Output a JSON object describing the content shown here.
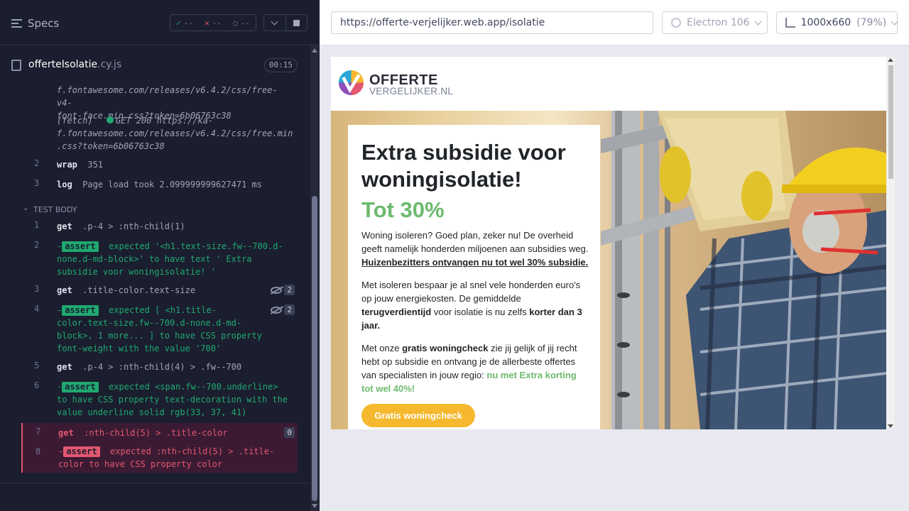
{
  "reporter": {
    "specs_label": "Specs",
    "stats": {
      "passed": "--",
      "failed": "--",
      "pending": "--"
    },
    "spec_file": {
      "name": "offerteIsolatie",
      "ext": ".cy.js",
      "timer": "00:15"
    },
    "log_lines": [
      {
        "num": "",
        "lines": [
          "f.fontawesome.com/releases/v6.4.2/css/free-v4-",
          "font-face.min.css?token=6b06763c38"
        ]
      },
      {
        "num": "",
        "prefix": "(fetch)",
        "method": "GET 200",
        "lines": [
          "https://ka-",
          "f.fontawesome.com/releases/v6.4.2/css/free.min",
          ".css?token=6b06763c38"
        ]
      },
      {
        "num": "2",
        "cmd": "wrap",
        "arg": "351"
      },
      {
        "num": "3",
        "cmd": "log",
        "arg": "Page load took 2.099999999627471 ms"
      }
    ],
    "test_body_label": "TEST BODY",
    "commands": [
      {
        "num": "1",
        "cmd": "get",
        "arg": ".p-4 > :nth-child(1)"
      },
      {
        "num": "2",
        "assert_l1": "expected  '<h1.text-size.fw--700.d-",
        "assert_l2": "none.d-md-block>'  to have text  ' Extra",
        "assert_l3": "subsidie voor woningisolatie! '"
      },
      {
        "num": "3",
        "cmd": "get",
        "arg": ".title-color.text-size",
        "badge": "2"
      },
      {
        "num": "4",
        "a1": "expected  [ <h1.title-",
        "a2": "color.text-size.fw--700.d-none.d-md-",
        "a3": "block>, 1 more... ]  to have CSS property",
        "a4": "font-weight  with the value  '700'",
        "badge": "2"
      },
      {
        "num": "5",
        "cmd": "get",
        "arg": ".p-4 > :nth-child(4) > .fw--700"
      },
      {
        "num": "6",
        "a1": "expected  <span.fw--700.underline>",
        "a2": "to have CSS property  text-decoration  with the",
        "a3": "value  underline solid rgb(33, 37, 41)"
      },
      {
        "num": "7",
        "cmd": "get",
        "arg": ":nth-child(5) > .title-color",
        "badge": "0"
      },
      {
        "num": "8",
        "a1": "expected  :nth-child(5) > .title-",
        "a2": "color  to have CSS property  color"
      }
    ],
    "assert_label": "assert"
  },
  "aut": {
    "url": "https://offerte-verjelijker.web.app/isolatie",
    "browser": "Electron 106",
    "viewport": "1000x660",
    "zoom": "(79%)"
  },
  "site": {
    "logo_line1": "OFFERTE",
    "logo_line2": "VERGELIJKER.NL",
    "hero_title": "Extra subsidie voor woningisolatie!",
    "hero_pct": "Tot 30%",
    "p1_text": "Woning isoleren? Goed plan, zeker nu! De overheid geeft namelijk honderden miljoenen aan subsidies weg. ",
    "p1_bold": "Huizenbezitters ontvangen nu tot wel 30% subsidie.",
    "p2_a": "Met isoleren bespaar je al snel vele honderden euro's op jouw energiekosten. De gemiddelde ",
    "p2_b": "terugverdientijd",
    "p2_c": " voor isolatie is nu zelfs ",
    "p2_d": "korter dan 3 jaar.",
    "p3_a": "Met onze ",
    "p3_b": "gratis woningcheck",
    "p3_c": " zie jij gelijk of jij recht hebt op subsidie en ontvang je de allerbeste offertes van specialisten in jouw regio: ",
    "p3_d": "nu met Extra korting tot wel 40%!",
    "cta": "Gratis woningcheck"
  },
  "colors": {
    "pass": "#1fa971",
    "fail": "#e45770",
    "accent_green": "#6dba6e",
    "cta_yellow": "#f5b82e"
  }
}
